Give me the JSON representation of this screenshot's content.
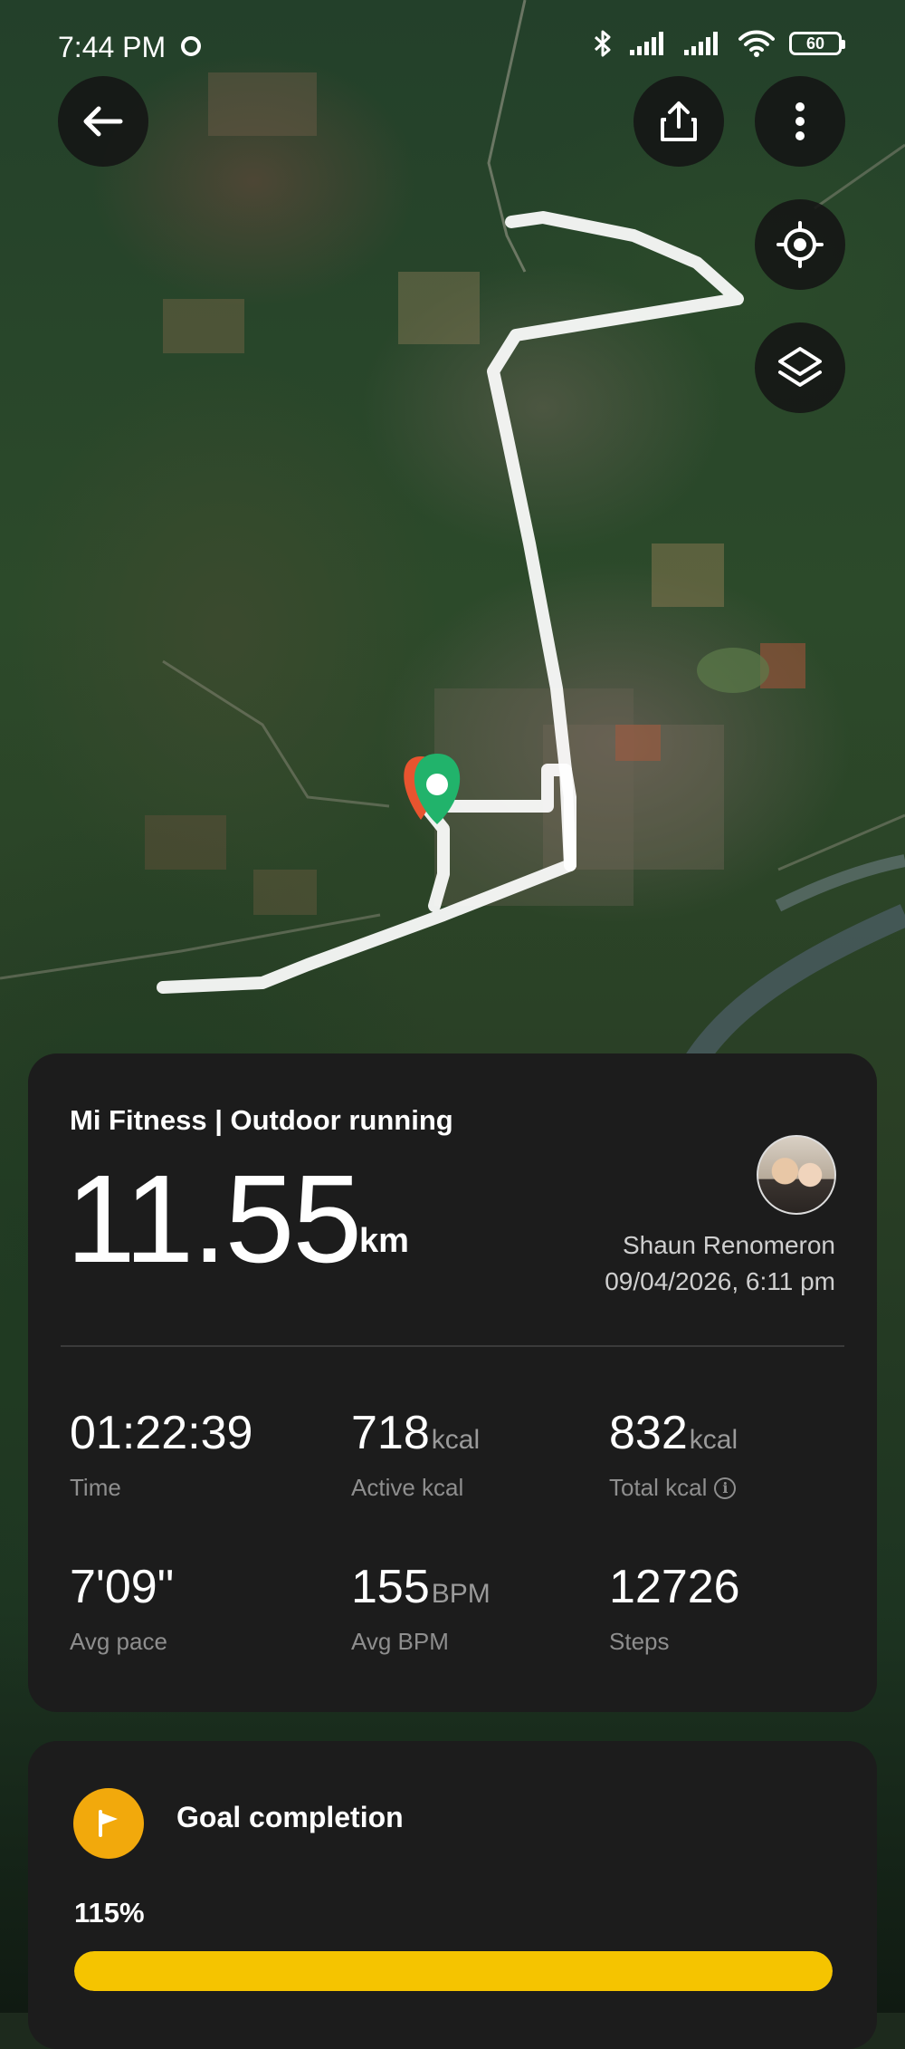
{
  "status_bar": {
    "time": "7:44 PM",
    "battery": "60"
  },
  "map": {
    "route_color": "#ffffff",
    "start_marker_color": "#e8542f",
    "end_marker_color": "#21b36b"
  },
  "toolbar": {
    "back_icon": "arrow-left-icon",
    "share_icon": "share-icon",
    "more_icon": "more-vertical-icon",
    "locate_icon": "locate-icon",
    "layers_icon": "layers-icon"
  },
  "activity": {
    "title": "Mi Fitness | Outdoor running",
    "distance": "11.55",
    "distance_unit": "km",
    "user_name": "Shaun Renomeron",
    "date": "09/04/2026, 6:11 pm"
  },
  "metrics": [
    {
      "value": "01:22:39",
      "unit": "",
      "label": "Time"
    },
    {
      "value": "718",
      "unit": "kcal",
      "label": "Active kcal"
    },
    {
      "value": "832",
      "unit": "kcal",
      "label": "Total kcal"
    },
    {
      "value": "7'09\"",
      "unit": "",
      "label": "Avg pace"
    },
    {
      "value": "155",
      "unit": "BPM",
      "label": "Avg BPM"
    },
    {
      "value": "12726",
      "unit": "",
      "label": "Steps"
    }
  ],
  "goal": {
    "title": "Goal completion",
    "percent_label": "115%",
    "progress_fraction": 1.0,
    "accent_color": "#f5c400"
  }
}
